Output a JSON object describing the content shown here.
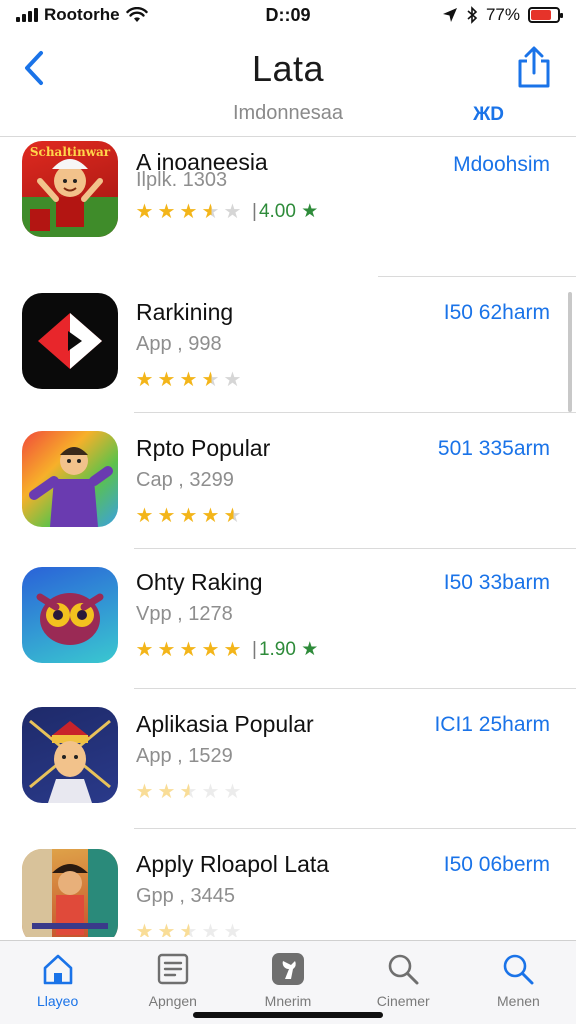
{
  "status_bar": {
    "carrier": "Rootorhe",
    "time": "D::09",
    "battery": "77%",
    "battery_level": 0.77,
    "battery_color": "#e6332a"
  },
  "nav": {
    "back_icon": "chevron-left-icon",
    "title": "Lata",
    "share_icon": "share-icon",
    "region": "Imdonnesaa",
    "right_link": "ЖD"
  },
  "accent_color": "#1a73e8",
  "apps": [
    {
      "name": "A inoaneesia",
      "meta": "Ilplk. 1303",
      "rating": 3.5,
      "rating_value": "4.00 ★",
      "action": "Mdoohsim",
      "icon": "cartoon-character-icon",
      "icon_label": "Schaltinwar"
    },
    {
      "name": "Rarkining",
      "meta": "App , 998",
      "rating": 3.5,
      "rating_value": "",
      "action": "I50 62harm",
      "icon": "play-logo-icon"
    },
    {
      "name": "Rpto Popular",
      "meta": "Cap , 3299",
      "rating": 4.5,
      "rating_value": "",
      "action": "501 335arm",
      "icon": "hero-character-icon"
    },
    {
      "name": "Ohty Raking",
      "meta": "Vpp , 1278",
      "rating": 5,
      "rating_value": "1.90 ★",
      "action": "I50 33barm",
      "icon": "owl-mask-icon"
    },
    {
      "name": "Aplikasia Popular",
      "meta": "App , 1529",
      "rating": 2.5,
      "rating_value": "",
      "action": "ICI1 25harm",
      "icon": "warrior-portrait-icon"
    },
    {
      "name": "Apply Rloapol Lata",
      "meta": "Gpp , 3445",
      "rating": 2.5,
      "rating_value": "",
      "action": "I50 06berm",
      "icon": "street-boy-icon"
    }
  ],
  "tabs": [
    {
      "label": "Llayeo",
      "icon": "home-icon",
      "active": true
    },
    {
      "label": "Apngen",
      "icon": "list-icon",
      "active": false
    },
    {
      "label": "Mnerim",
      "icon": "tool-icon",
      "active": false
    },
    {
      "label": "Cinemer",
      "icon": "search-icon",
      "active": false
    },
    {
      "label": "Menen",
      "icon": "search-icon",
      "active": false
    }
  ]
}
